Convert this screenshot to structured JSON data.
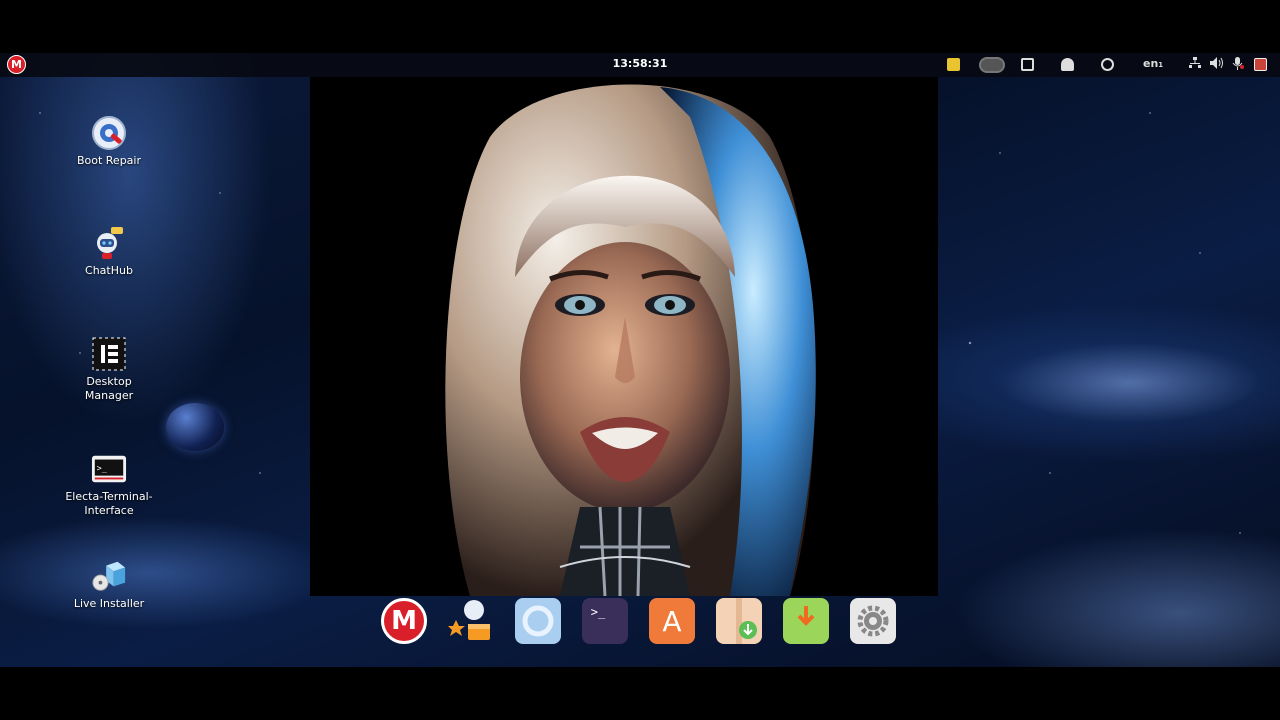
{
  "topbar": {
    "menu_logo_letter": "M",
    "clock": "13:58:31",
    "keyboard_layout": "en",
    "keyboard_layout_sub": "1"
  },
  "desktop_icons": [
    {
      "label": "Boot Repair",
      "icon": "boot-repair-icon"
    },
    {
      "label": "ChatHub",
      "icon": "chathub-icon"
    },
    {
      "label": "Desktop Manager",
      "icon": "desktop-manager-icon"
    },
    {
      "label": "Electa-Terminal-Interface",
      "icon": "terminal-icon"
    },
    {
      "label": "Live Installer",
      "icon": "live-installer-icon"
    }
  ],
  "dock": {
    "items": [
      {
        "name": "menu-app",
        "icon": "m-logo-icon",
        "letter": "M",
        "color": "#d9202a"
      },
      {
        "name": "favorites-app",
        "icon": "favorites-icon",
        "color": "#f59a23"
      },
      {
        "name": "browser-app",
        "icon": "browser-icon",
        "color": "#7fb5e8"
      },
      {
        "name": "terminal-app",
        "icon": "terminal-icon",
        "glyph": ">_",
        "color": "#3a2f5a"
      },
      {
        "name": "app-store",
        "icon": "app-store-icon",
        "letter": "A",
        "color": "#f07a3a"
      },
      {
        "name": "package-installer",
        "icon": "package-icon",
        "color": "#f3d2b5"
      },
      {
        "name": "download-manager",
        "icon": "download-icon",
        "color": "#9bd55a"
      },
      {
        "name": "settings-app",
        "icon": "settings-gear-icon",
        "color": "#e8e8e8"
      }
    ]
  },
  "colors": {
    "accent_red": "#d9202a",
    "topbar_bg": "#080a12"
  }
}
